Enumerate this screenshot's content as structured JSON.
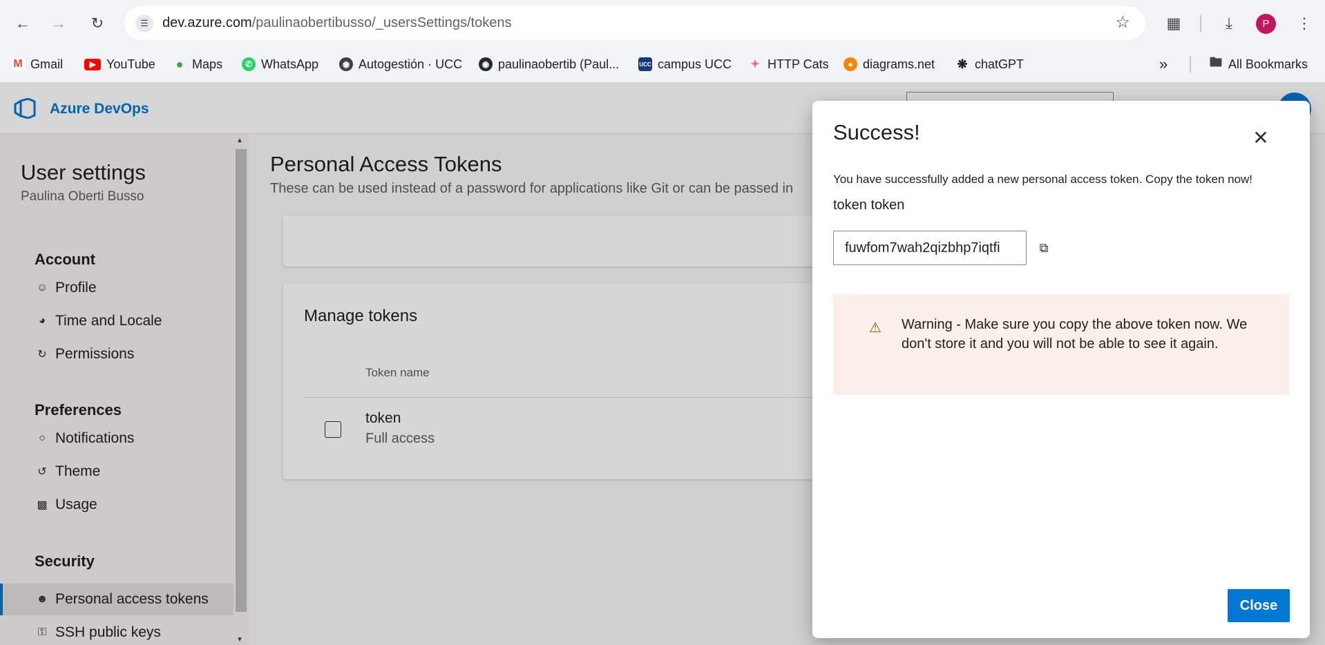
{
  "browser": {
    "url_host": "dev.azure.com",
    "url_path": "/paulinaobertibusso/_usersSettings/tokens",
    "profile_initial": "P",
    "profile_color": "#c2185b",
    "bookmarks": [
      {
        "label": "Gmail",
        "icon": "gmail-icon"
      },
      {
        "label": "YouTube",
        "icon": "youtube-icon"
      },
      {
        "label": "Maps",
        "icon": "maps-icon"
      },
      {
        "label": "WhatsApp",
        "icon": "whatsapp-icon"
      },
      {
        "label": "Autogestión · UCC",
        "icon": "globe-icon"
      },
      {
        "label": "paulinaobertib (Paul...",
        "icon": "github-icon"
      },
      {
        "label": "campus UCC",
        "icon": "ucc-icon"
      },
      {
        "label": "HTTP Cats",
        "icon": "cat-icon"
      },
      {
        "label": "diagrams.net",
        "icon": "diagrams-icon"
      },
      {
        "label": "chatGPT",
        "icon": "openai-icon"
      }
    ],
    "all_bookmarks": "All Bookmarks"
  },
  "app": {
    "name": "Azure DevOps",
    "accent": "#0078d4"
  },
  "sidebar": {
    "title": "User settings",
    "user": "Paulina Oberti Busso",
    "sections": {
      "account": "Account",
      "preferences": "Preferences",
      "security": "Security"
    },
    "items": {
      "profile": "Profile",
      "time_locale": "Time and Locale",
      "permissions": "Permissions",
      "notifications": "Notifications",
      "theme": "Theme",
      "usage": "Usage",
      "pat": "Personal access tokens",
      "ssh": "SSH public keys"
    }
  },
  "main": {
    "title": "Personal Access Tokens",
    "description": "These can be used instead of a password for applications like Git or can be passed in",
    "manage_title": "Manage tokens",
    "column_token_name": "Token name",
    "tokens": [
      {
        "name": "token",
        "scope": "Full access"
      }
    ]
  },
  "dialog": {
    "title": "Success!",
    "message": "You have successfully added a new personal access token. Copy the token now!",
    "token_label": "token token",
    "token_value": "fuwfom7wah2qizbhp7iqtfi",
    "warning": "Warning - Make sure you copy the above token now. We don't store it and you will not be able to see it again.",
    "warning_bg": "#fbf0e9",
    "close_label": "Close"
  }
}
